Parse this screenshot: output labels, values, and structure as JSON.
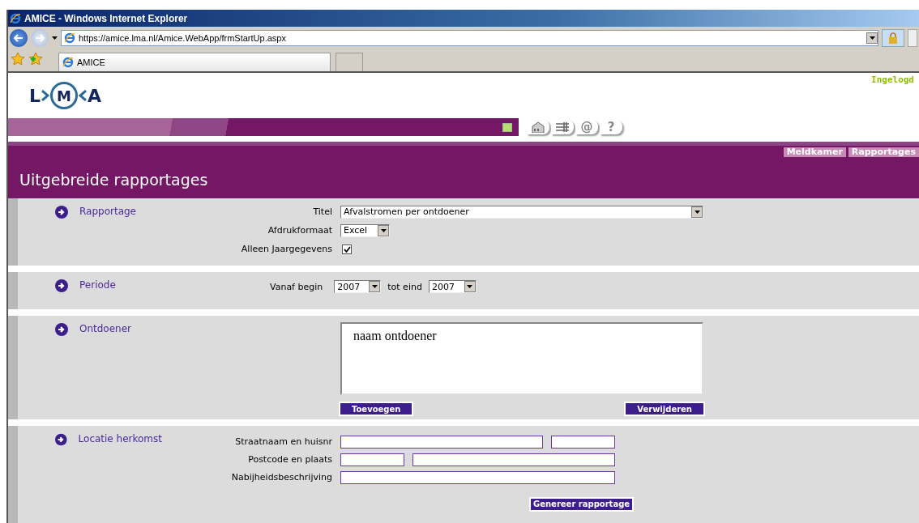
{
  "browser": {
    "title": "AMICE - Windows Internet Explorer",
    "address": "https://amice.lma.nl/Amice.WebApp/frmStartUp.aspx",
    "tab_title": "AMICE"
  },
  "header": {
    "logo_letters": [
      "L",
      "M",
      "A"
    ],
    "status": "Ingelogd",
    "toolbar": [
      {
        "kind": "house"
      },
      {
        "kind": "rack"
      },
      {
        "kind": "glyph",
        "text": "@"
      },
      {
        "kind": "glyph",
        "text": "?"
      }
    ],
    "nav": [
      {
        "label": "Meldkamer"
      },
      {
        "label": "Rapportages"
      }
    ]
  },
  "page_title": "Uitgebreide rapportages",
  "sections": [
    {
      "title": "Rapportage",
      "kind": "form",
      "rows": [
        {
          "kind": "long_select",
          "label": "Titel",
          "value": "Afvalstromen per ontdoener"
        },
        {
          "kind": "select",
          "label": "Afdrukformaat",
          "value": "Excel"
        },
        {
          "kind": "checkbox",
          "label": "Alleen Jaargegevens",
          "checked": true
        }
      ]
    },
    {
      "title": "Periode",
      "kind": "period",
      "from_label": "Vanaf begin",
      "from": "2007",
      "to_label": "tot eind",
      "to": "2007"
    },
    {
      "title": "Ontdoener",
      "kind": "list",
      "items": [
        "naam ontdoener"
      ],
      "buttons": [
        "Toevoegen",
        "Verwijderen"
      ]
    },
    {
      "title": "Locatie herkomst",
      "kind": "address",
      "rows": [
        {
          "kind": "long_short",
          "label": "Straatnaam en huisnr"
        },
        {
          "kind": "short_long",
          "label": "Postcode en plaats"
        },
        {
          "kind": "single",
          "label": "Nabijheidsbeschrijving"
        }
      ],
      "button": "Genereer rapportage"
    }
  ]
}
